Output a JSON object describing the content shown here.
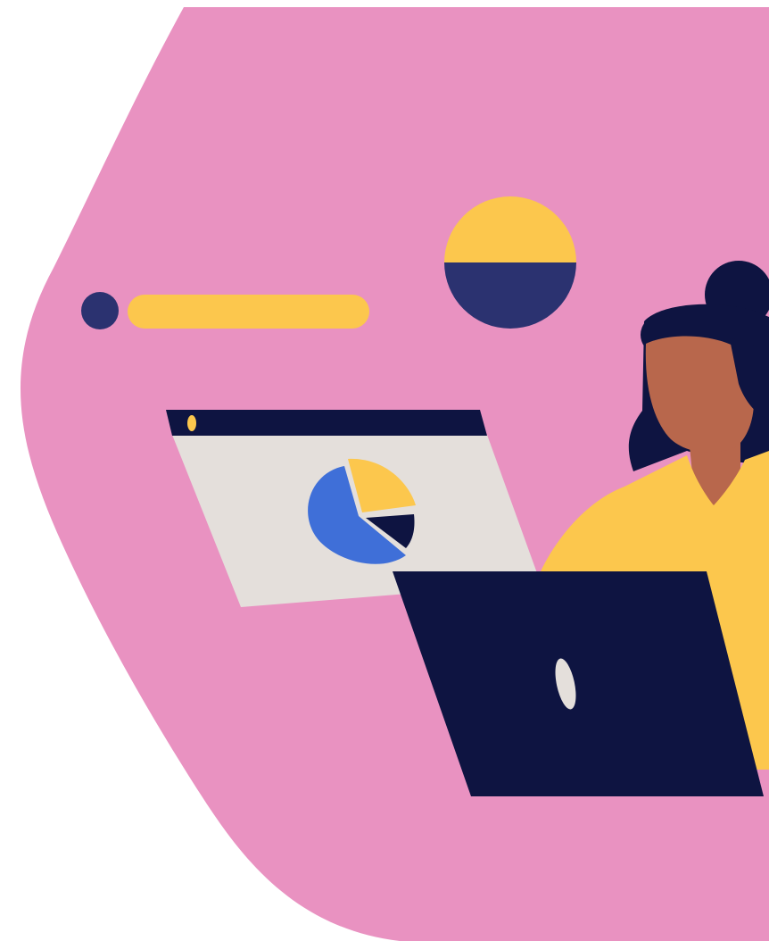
{
  "illustration": {
    "subject": "person-with-laptop-and-pie-chart-window",
    "colors": {
      "background": "#ffffff",
      "blob": "#e992c1",
      "navy": "#0e1441",
      "indigo": "#2b3270",
      "yellow": "#fcc74d",
      "skin": "#b8674c",
      "panel": "#e4dfdb",
      "blue": "#3f6fd8",
      "cream": "#e4dfdb"
    },
    "icons": {
      "progress_dot": "dot-icon",
      "progress_pill": "progress-bar",
      "half_circle": "half-circle-icon",
      "browser_window": "browser-window-icon",
      "pie_chart": "pie-chart-icon",
      "laptop": "laptop-icon",
      "person": "person-figure"
    }
  }
}
